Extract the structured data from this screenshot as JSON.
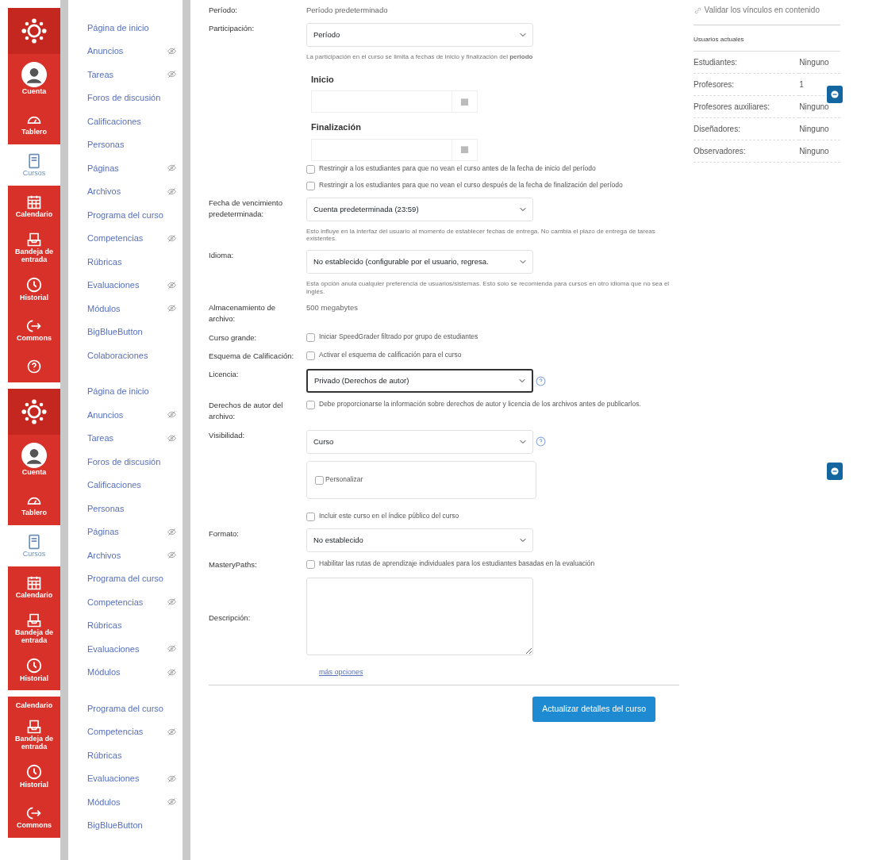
{
  "global_nav": [
    {
      "items": [
        {
          "kind": "logo",
          "selected": false
        },
        {
          "kind": "account",
          "label": "Cuenta",
          "selected": false
        },
        {
          "kind": "dashboard",
          "label": "Tablero",
          "selected": false
        },
        {
          "kind": "courses",
          "label": "Cursos",
          "selected": true
        },
        {
          "kind": "calendar",
          "label": "Calendario",
          "selected": false
        },
        {
          "kind": "inbox",
          "label": "Bandeja de entrada",
          "selected": false
        },
        {
          "kind": "history",
          "label": "Historial",
          "selected": false
        },
        {
          "kind": "commons",
          "label": "Commons",
          "selected": false
        },
        {
          "kind": "help",
          "selected": false
        }
      ]
    },
    {
      "items": [
        {
          "kind": "logo",
          "selected": false
        },
        {
          "kind": "account",
          "label": "Cuenta",
          "selected": false
        },
        {
          "kind": "dashboard",
          "label": "Tablero",
          "selected": false
        },
        {
          "kind": "courses",
          "label": "Cursos",
          "selected": true
        },
        {
          "kind": "calendar",
          "label": "Calendario",
          "selected": false
        },
        {
          "kind": "inbox",
          "label": "Bandeja de entrada",
          "selected": false
        },
        {
          "kind": "history",
          "label": "Historial",
          "selected": false
        }
      ]
    },
    {
      "items": [
        {
          "kind": "partial",
          "label": "Calendario",
          "selected": false
        },
        {
          "kind": "inbox",
          "label": "Bandeja de entrada",
          "selected": false
        },
        {
          "kind": "history",
          "label": "Historial",
          "selected": false
        },
        {
          "kind": "commons",
          "label": "Commons",
          "selected": false
        }
      ]
    }
  ],
  "course_nav": [
    {
      "items": [
        {
          "label": "Página de inicio",
          "hidden": false
        },
        {
          "label": "Anuncios",
          "hidden": true
        },
        {
          "label": "Tareas",
          "hidden": true
        },
        {
          "label": "Foros de discusión",
          "hidden": false
        },
        {
          "label": "Calificaciones",
          "hidden": false
        },
        {
          "label": "Personas",
          "hidden": false
        },
        {
          "label": "Páginas",
          "hidden": true
        },
        {
          "label": "Archivos",
          "hidden": true
        },
        {
          "label": "Programa del curso",
          "hidden": false
        },
        {
          "label": "Competencias",
          "hidden": true
        },
        {
          "label": "Rúbricas",
          "hidden": false
        },
        {
          "label": "Evaluaciones",
          "hidden": true
        },
        {
          "label": "Módulos",
          "hidden": true
        },
        {
          "label": "BigBlueButton",
          "hidden": false
        },
        {
          "label": "Colaboraciones",
          "hidden": false
        }
      ]
    },
    {
      "items": [
        {
          "label": "Página de inicio",
          "hidden": false
        },
        {
          "label": "Anuncios",
          "hidden": true
        },
        {
          "label": "Tareas",
          "hidden": true
        },
        {
          "label": "Foros de discusión",
          "hidden": false
        },
        {
          "label": "Calificaciones",
          "hidden": false
        },
        {
          "label": "Personas",
          "hidden": false
        },
        {
          "label": "Páginas",
          "hidden": true
        },
        {
          "label": "Archivos",
          "hidden": true
        },
        {
          "label": "Programa del curso",
          "hidden": false
        },
        {
          "label": "Competencias",
          "hidden": true
        },
        {
          "label": "Rúbricas",
          "hidden": false
        },
        {
          "label": "Evaluaciones",
          "hidden": true
        },
        {
          "label": "Módulos",
          "hidden": true
        }
      ]
    },
    {
      "items": [
        {
          "label": "Programa del curso",
          "hidden": false
        },
        {
          "label": "Competencias",
          "hidden": true
        },
        {
          "label": "Rúbricas",
          "hidden": false
        },
        {
          "label": "Evaluaciones",
          "hidden": true
        },
        {
          "label": "Módulos",
          "hidden": true
        },
        {
          "label": "BigBlueButton",
          "hidden": false
        }
      ]
    }
  ],
  "form": {
    "rows": [
      {
        "kind": "text",
        "label": "Período:",
        "value": "Período predeterminado"
      },
      {
        "kind": "select",
        "label": "Participación:",
        "value": "Período",
        "help": "La participación en el curso se limita a fechas de inicio y finalización del **periodo**",
        "focused": false,
        "info": false
      },
      {
        "kind": "date",
        "heading": "Inicio"
      },
      {
        "kind": "date",
        "heading": "Finalización"
      },
      {
        "kind": "checkbox",
        "text": "Restringir a los estudiantes para que no vean el curso antes de la fecha de inicio del período",
        "checked": false
      },
      {
        "kind": "checkbox",
        "text": "Restringir a los estudiantes para que no vean el curso después de la fecha de finalización del período",
        "checked": false
      },
      {
        "kind": "select",
        "label": "Fecha de vencimiento predeterminada:",
        "value": "Cuenta predeterminada (23:59)",
        "help": "Esto influye en la interfaz del usuario al momento de establecer fechas de entrega. No cambia el plazo de entrega de tareas existentes.",
        "focused": false,
        "info": false
      },
      {
        "kind": "select",
        "label": "Idioma:",
        "value": "No establecido (configurable por el usuario, regresa.",
        "help": "Esta opción anula cualquier preferencia de usuarios/sistemas. Esto solo se recomienda para cursos en otro idioma que no sea el inglés.",
        "focused": false,
        "info": false
      },
      {
        "kind": "text",
        "label": "Almacenamiento de archivo:",
        "value": "500 megabytes"
      },
      {
        "kind": "checkbox",
        "label": "Curso grande:",
        "text": "Iniciar SpeedGrader filtrado por grupo de estudiantes",
        "checked": false
      },
      {
        "kind": "checkbox",
        "label": "Esquema de Calificación:",
        "text": "Activar el esquema de calificación para el curso",
        "checked": false
      },
      {
        "kind": "select",
        "label": "Licencia:",
        "value": "Privado (Derechos de autor)",
        "focused": true,
        "info": true
      },
      {
        "kind": "checkbox",
        "label": "Derechos de autor del archivo:",
        "text": "Debe proporcionarse la información sobre derechos de autor y licencia de los archivos antes de publicarlos.",
        "checked": false
      },
      {
        "kind": "select",
        "label": "Visibilidad:",
        "value": "Curso",
        "focused": false,
        "info": true
      },
      {
        "kind": "panel",
        "text": "Personalizar",
        "checked": false
      },
      {
        "kind": "checkbox",
        "text": "Incluir este curso en el índice público del curso",
        "checked": false
      },
      {
        "kind": "select",
        "label": "Formato:",
        "value": "No establecido",
        "focused": false,
        "info": false
      },
      {
        "kind": "checkbox",
        "label": "MasteryPaths:",
        "text": "Habilitar las rutas de aprendizaje individuales para los estudiantes basadas en la evaluación",
        "checked": false
      },
      {
        "kind": "textarea",
        "label": "Descripción:"
      },
      {
        "kind": "link",
        "text": "más opciones"
      }
    ],
    "submit": "Actualizar detalles del curso"
  },
  "sidebar": {
    "validate_link": "Validar los vínculos en contenido",
    "users_title": "Usuarios actuales",
    "users": [
      {
        "label": "Estudiantes:",
        "value": "Ninguno"
      },
      {
        "label": "Profesores:",
        "value": "1"
      },
      {
        "label": "Profesores auxiliares:",
        "value": "Ninguno"
      },
      {
        "label": "Diseñadores:",
        "value": "Ninguno"
      },
      {
        "label": "Observadores:",
        "value": "Ninguno"
      }
    ]
  }
}
